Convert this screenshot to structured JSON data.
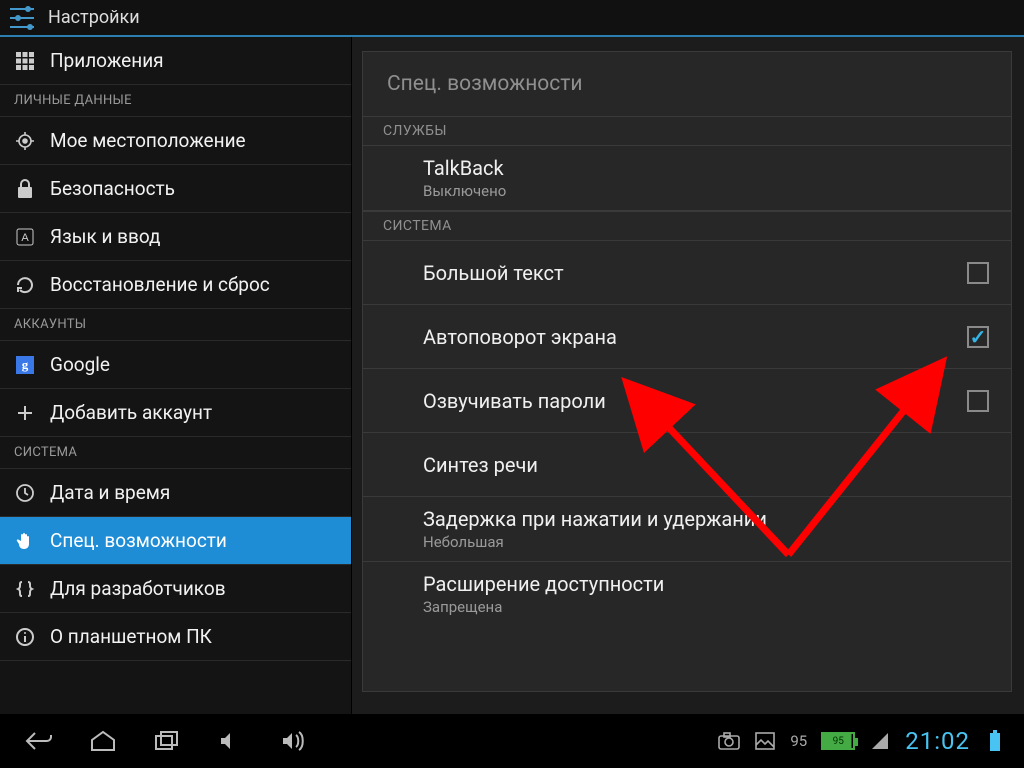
{
  "titlebar": {
    "title": "Настройки"
  },
  "sidebar": {
    "items": [
      {
        "id": "apps",
        "label": "Приложения",
        "icon": "apps-icon"
      },
      {
        "cat": "ЛИЧНЫЕ ДАННЫЕ"
      },
      {
        "id": "location",
        "label": "Мое местоположение",
        "icon": "location-icon"
      },
      {
        "id": "security",
        "label": "Безопасность",
        "icon": "lock-icon"
      },
      {
        "id": "lang",
        "label": "Язык и ввод",
        "icon": "language-icon"
      },
      {
        "id": "backup",
        "label": "Восстановление и сброс",
        "icon": "refresh-icon"
      },
      {
        "cat": "АККАУНТЫ"
      },
      {
        "id": "google",
        "label": "Google",
        "icon": "google-icon"
      },
      {
        "id": "addacct",
        "label": "Добавить аккаунт",
        "icon": "plus-icon"
      },
      {
        "cat": "СИСТЕМА"
      },
      {
        "id": "datetime",
        "label": "Дата и время",
        "icon": "clock-icon"
      },
      {
        "id": "access",
        "label": "Спец. возможности",
        "icon": "hand-icon",
        "selected": true
      },
      {
        "id": "dev",
        "label": "Для разработчиков",
        "icon": "braces-icon"
      },
      {
        "id": "about",
        "label": "О планшетном ПК",
        "icon": "info-icon"
      }
    ]
  },
  "detail": {
    "title": "Спец. возможности",
    "sections": [
      {
        "header": "СЛУЖБЫ",
        "items": [
          {
            "id": "talkback",
            "label": "TalkBack",
            "sub": "Выключено",
            "type": "link"
          }
        ]
      },
      {
        "header": "СИСТЕМА",
        "items": [
          {
            "id": "bigtext",
            "label": "Большой текст",
            "type": "checkbox",
            "checked": false
          },
          {
            "id": "autorot",
            "label": "Автоповорот экрана",
            "type": "checkbox",
            "checked": true
          },
          {
            "id": "speakpwd",
            "label": "Озвучивать пароли",
            "type": "checkbox",
            "checked": false
          },
          {
            "id": "tts",
            "label": "Синтез речи",
            "type": "link"
          },
          {
            "id": "longpress",
            "label": "Задержка при нажатии и удержании",
            "sub": "Небольшая",
            "type": "link"
          },
          {
            "id": "extacc",
            "label": "Расширение доступности",
            "sub": "Запрещена",
            "type": "link"
          }
        ]
      }
    ]
  },
  "navbar": {
    "battery_pct": "95",
    "battery_label": "95",
    "clock": "21:02"
  },
  "annotation_arrows": {
    "arrow1": {
      "desc": "to auto-rotate label"
    },
    "arrow2": {
      "desc": "to auto-rotate checkbox"
    }
  }
}
